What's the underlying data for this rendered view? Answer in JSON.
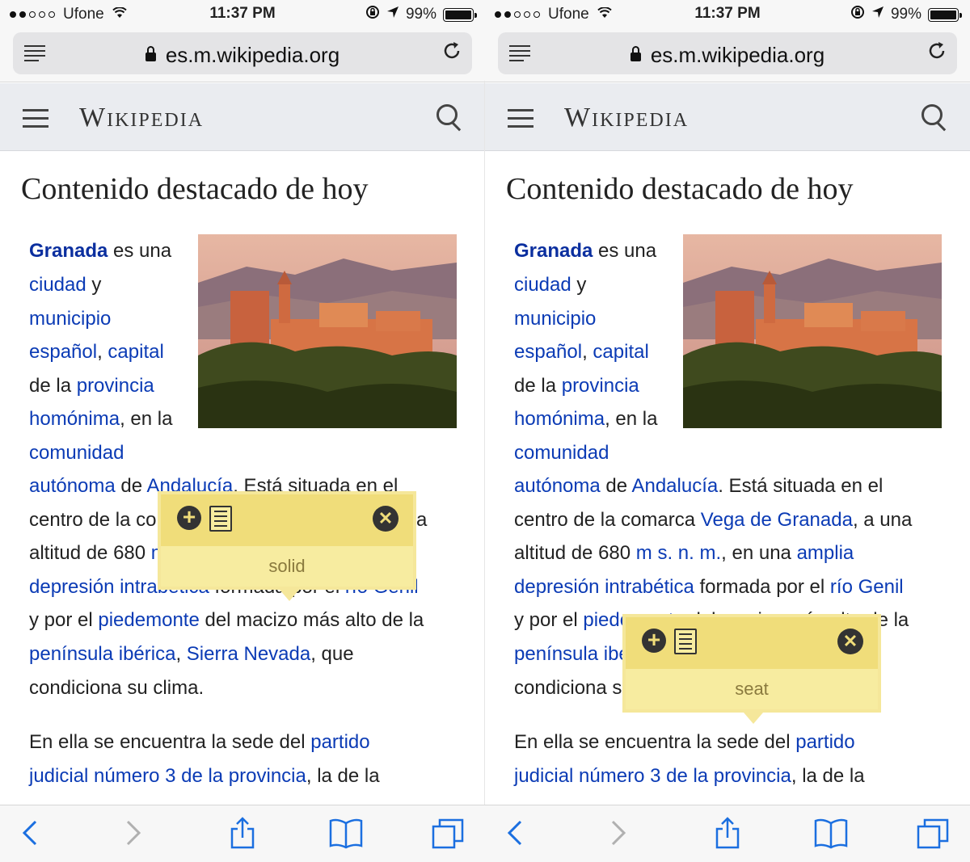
{
  "status": {
    "carrier": "Ufone",
    "time": "11:37 PM",
    "battery": "99%",
    "battery_level": 0.99
  },
  "browser": {
    "url": "es.m.wikipedia.org"
  },
  "wiki": {
    "wordmark": "Wikipedia",
    "heading": "Contenido destacado de hoy"
  },
  "article": {
    "lines": [
      [
        {
          "t": "Granada",
          "k": "bold"
        },
        {
          "t": " es una",
          "k": "text"
        }
      ],
      [
        {
          "t": "ciudad",
          "k": "link"
        },
        {
          "t": " y",
          "k": "text"
        }
      ],
      [
        {
          "t": "municipio",
          "k": "link"
        }
      ],
      [
        {
          "t": "español",
          "k": "link"
        },
        {
          "t": ", ",
          "k": "text"
        },
        {
          "t": "capital",
          "k": "link"
        }
      ],
      [
        {
          "t": "de la ",
          "k": "text"
        },
        {
          "t": "provincia",
          "k": "link"
        }
      ],
      [
        {
          "t": "homónima",
          "k": "link"
        },
        {
          "t": ", en la",
          "k": "text"
        }
      ],
      [
        {
          "t": "comunidad",
          "k": "link"
        }
      ],
      [
        {
          "t": "autónoma",
          "k": "link"
        },
        {
          "t": " de ",
          "k": "text"
        },
        {
          "t": "Andalucía",
          "k": "link"
        },
        {
          "t": ". Está situada en el",
          "k": "text"
        }
      ],
      [
        {
          "t": "centro de la comarca ",
          "k": "text"
        },
        {
          "t": "Vega de Granada",
          "k": "link"
        },
        {
          "t": ", a una",
          "k": "text"
        }
      ],
      [
        {
          "t": "altitud de 680 ",
          "k": "text"
        },
        {
          "t": "m s. n. m.",
          "k": "link"
        },
        {
          "t": ", en una ",
          "k": "text"
        },
        {
          "t": "amplia",
          "k": "link"
        }
      ],
      [
        {
          "t": "depresión intrabética",
          "k": "link"
        },
        {
          "t": " formada por el ",
          "k": "text"
        },
        {
          "t": "río Genil",
          "k": "link"
        }
      ],
      [
        {
          "t": "y por el ",
          "k": "text"
        },
        {
          "t": "piedemonte",
          "k": "link"
        },
        {
          "t": " del macizo más alto de la",
          "k": "text"
        }
      ],
      [
        {
          "t": "península ibérica",
          "k": "link"
        },
        {
          "t": ", ",
          "k": "text"
        },
        {
          "t": "Sierra Nevada",
          "k": "link"
        },
        {
          "t": ", que",
          "k": "text"
        }
      ],
      [
        {
          "t": "condiciona su clima.",
          "k": "text"
        }
      ],
      [
        {
          "t": "En ella se encuentra la sede del ",
          "k": "text"
        },
        {
          "t": "partido",
          "k": "link"
        }
      ],
      [
        {
          "t": "judicial número 3 de la provincia",
          "k": "link"
        },
        {
          "t": ", la de la",
          "k": "text"
        }
      ]
    ]
  },
  "popups": {
    "left_word": "solid",
    "right_word": "seat"
  },
  "toolbar": {
    "icons": [
      "back-icon",
      "forward-icon",
      "share-icon",
      "bookmarks-icon",
      "tabs-icon"
    ]
  }
}
